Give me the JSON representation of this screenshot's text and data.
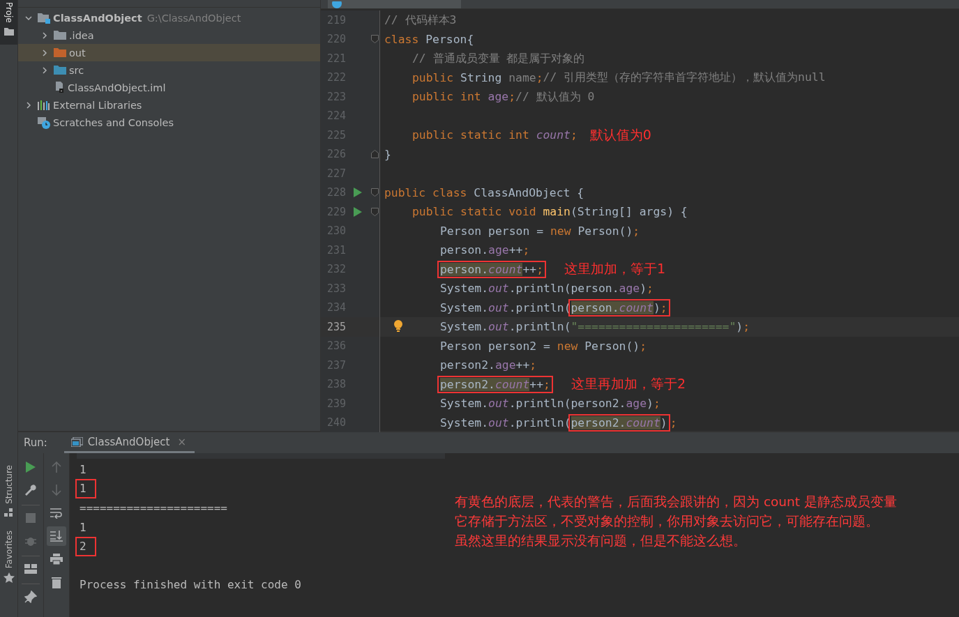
{
  "side_strip": [
    {
      "label": "Proje",
      "kind": "project",
      "selected": true
    },
    {
      "label": "Structure",
      "kind": "structure",
      "selected": false
    },
    {
      "label": "Favorites",
      "kind": "favorites",
      "selected": false
    }
  ],
  "project_tree": [
    {
      "name": "ClassAndObject",
      "path": "G:\\ClassAndObject",
      "kind": "module",
      "expanded": true,
      "selected": false,
      "children": [
        {
          "name": ".idea",
          "kind": "folder",
          "expanded": false,
          "selected": false
        },
        {
          "name": "out",
          "kind": "excluded_folder",
          "expanded": false,
          "selected": true
        },
        {
          "name": "src",
          "kind": "source_folder",
          "expanded": false,
          "selected": false
        },
        {
          "name": "ClassAndObject.iml",
          "kind": "module_file",
          "selected": false
        }
      ]
    },
    {
      "name": "External Libraries",
      "kind": "libraries",
      "expanded": false,
      "selected": false
    },
    {
      "name": "Scratches and Consoles",
      "kind": "scratches",
      "selected": false
    }
  ],
  "editor": {
    "lines": [
      {
        "number": "219",
        "current": false,
        "tokens": [
          {
            "kind": "comment",
            "text": "// 代码样本3"
          }
        ]
      },
      {
        "number": "220",
        "current": false,
        "fold_start": true,
        "tokens": [
          {
            "kind": "keyword",
            "text": "class "
          },
          {
            "kind": "plain",
            "text": "Person{"
          }
        ],
        "children": [
          {
            "number": "221",
            "current": false,
            "tokens": [
              {
                "kind": "comment",
                "text": "// 普通成员变量 都是属于对象的"
              }
            ]
          },
          {
            "number": "222",
            "current": false,
            "tokens": [
              {
                "kind": "keyword",
                "text": "public "
              },
              {
                "kind": "plain",
                "text": "String "
              },
              {
                "kind": "unused",
                "text": "name"
              },
              {
                "kind": "keyword",
                "text": ";"
              },
              {
                "kind": "comment",
                "text": "// 引用类型（存的字符串首字符地址），默认值为null"
              }
            ]
          },
          {
            "number": "223",
            "current": false,
            "tokens": [
              {
                "kind": "keyword",
                "text": "public int "
              },
              {
                "kind": "field",
                "text": "age"
              },
              {
                "kind": "keyword",
                "text": ";"
              },
              {
                "kind": "comment",
                "text": "// 默认值为 0"
              }
            ]
          },
          {
            "number": "224",
            "current": false
          },
          {
            "number": "225",
            "current": false,
            "tokens": [
              {
                "kind": "keyword",
                "text": "public static int "
              },
              {
                "kind": "static",
                "text": "count"
              },
              {
                "kind": "keyword",
                "text": ";"
              },
              {
                "kind": "note",
                "text": "默认值为0"
              }
            ]
          }
        ]
      },
      {
        "number": "226",
        "current": false,
        "fold_end": true,
        "tokens": [
          {
            "kind": "plain",
            "text": "}"
          }
        ]
      },
      {
        "number": "227",
        "current": false
      },
      {
        "number": "228",
        "current": false,
        "run": true,
        "fold_start": true,
        "tokens": [
          {
            "kind": "keyword",
            "text": "public class "
          },
          {
            "kind": "plain",
            "text": "ClassAndObject {"
          }
        ],
        "children": [
          {
            "number": "229",
            "current": false,
            "run": true,
            "fold_start": true,
            "tokens": [
              {
                "kind": "keyword",
                "text": "public static void "
              },
              {
                "kind": "method",
                "text": "main"
              },
              {
                "kind": "plain",
                "text": "(String[] args) {"
              }
            ],
            "children": [
              {
                "number": "230",
                "current": false,
                "tokens": [
                  {
                    "kind": "plain",
                    "text": "Person person = "
                  },
                  {
                    "kind": "keyword",
                    "text": "new "
                  },
                  {
                    "kind": "plain",
                    "text": "Person()"
                  },
                  {
                    "kind": "keyword",
                    "text": ";"
                  }
                ]
              },
              {
                "number": "231",
                "current": false,
                "tokens": [
                  {
                    "kind": "plain",
                    "text": "person."
                  },
                  {
                    "kind": "field",
                    "text": "age"
                  },
                  {
                    "kind": "plain",
                    "text": "++"
                  },
                  {
                    "kind": "keyword",
                    "text": ";"
                  }
                ]
              },
              {
                "number": "232",
                "current": false,
                "tokens": [
                  {
                    "kind": "box",
                    "children": [
                      {
                        "kind": "plain",
                        "text": "person.",
                        "warn": true
                      },
                      {
                        "kind": "static",
                        "text": "count",
                        "warn": true
                      },
                      {
                        "kind": "plain",
                        "text": "++"
                      },
                      {
                        "kind": "keyword",
                        "text": ";"
                      }
                    ]
                  },
                  {
                    "kind": "note",
                    "text": "这里加加，等于1"
                  }
                ]
              },
              {
                "number": "233",
                "current": false,
                "tokens": [
                  {
                    "kind": "plain",
                    "text": "System."
                  },
                  {
                    "kind": "static",
                    "text": "out"
                  },
                  {
                    "kind": "plain",
                    "text": ".println(person."
                  },
                  {
                    "kind": "field",
                    "text": "age"
                  },
                  {
                    "kind": "plain",
                    "text": ")"
                  },
                  {
                    "kind": "keyword",
                    "text": ";"
                  }
                ]
              },
              {
                "number": "234",
                "current": false,
                "tokens": [
                  {
                    "kind": "plain",
                    "text": "System."
                  },
                  {
                    "kind": "static",
                    "text": "out"
                  },
                  {
                    "kind": "plain",
                    "text": ".println("
                  },
                  {
                    "kind": "box",
                    "children": [
                      {
                        "kind": "plain",
                        "text": "person.",
                        "warn": true
                      },
                      {
                        "kind": "static",
                        "text": "count",
                        "warn": true
                      },
                      {
                        "kind": "plain",
                        "text": ")"
                      },
                      {
                        "kind": "keyword",
                        "text": ";"
                      }
                    ]
                  }
                ]
              },
              {
                "number": "235",
                "current": true,
                "bulb": true,
                "tokens": [
                  {
                    "kind": "plain",
                    "text": "System."
                  },
                  {
                    "kind": "static",
                    "text": "out"
                  },
                  {
                    "kind": "plain",
                    "text": ".println("
                  },
                  {
                    "kind": "string",
                    "text": "\"======================\""
                  },
                  {
                    "kind": "plain",
                    "text": ")"
                  },
                  {
                    "kind": "keyword",
                    "text": ";"
                  }
                ]
              },
              {
                "number": "236",
                "current": false,
                "tokens": [
                  {
                    "kind": "plain",
                    "text": "Person person2 = "
                  },
                  {
                    "kind": "keyword",
                    "text": "new "
                  },
                  {
                    "kind": "plain",
                    "text": "Person()"
                  },
                  {
                    "kind": "keyword",
                    "text": ";"
                  }
                ]
              },
              {
                "number": "237",
                "current": false,
                "tokens": [
                  {
                    "kind": "plain",
                    "text": "person2."
                  },
                  {
                    "kind": "field",
                    "text": "age"
                  },
                  {
                    "kind": "plain",
                    "text": "++"
                  },
                  {
                    "kind": "keyword",
                    "text": ";"
                  }
                ]
              },
              {
                "number": "238",
                "current": false,
                "tokens": [
                  {
                    "kind": "box",
                    "children": [
                      {
                        "kind": "plain",
                        "text": "person2.",
                        "warn": true
                      },
                      {
                        "kind": "static",
                        "text": "count",
                        "warn": true
                      },
                      {
                        "kind": "plain",
                        "text": "++"
                      },
                      {
                        "kind": "keyword",
                        "text": ";"
                      }
                    ]
                  },
                  {
                    "kind": "note",
                    "text": "这里再加加，等于2"
                  }
                ]
              },
              {
                "number": "239",
                "current": false,
                "tokens": [
                  {
                    "kind": "plain",
                    "text": "System."
                  },
                  {
                    "kind": "static",
                    "text": "out"
                  },
                  {
                    "kind": "plain",
                    "text": ".println(person2."
                  },
                  {
                    "kind": "field",
                    "text": "age"
                  },
                  {
                    "kind": "plain",
                    "text": ")"
                  },
                  {
                    "kind": "keyword",
                    "text": ";"
                  }
                ]
              },
              {
                "number": "240",
                "current": false,
                "tokens": [
                  {
                    "kind": "plain",
                    "text": "System."
                  },
                  {
                    "kind": "static",
                    "text": "out"
                  },
                  {
                    "kind": "plain",
                    "text": ".println("
                  },
                  {
                    "kind": "box",
                    "children": [
                      {
                        "kind": "plain",
                        "text": "person2.",
                        "warn": true
                      },
                      {
                        "kind": "static",
                        "text": "count",
                        "warn": true
                      },
                      {
                        "kind": "plain",
                        "text": ")"
                      }
                    ]
                  },
                  {
                    "kind": "keyword",
                    "text": ";"
                  }
                ]
              }
            ]
          }
        ]
      }
    ]
  },
  "run_panel": {
    "label": "Run:",
    "tab": {
      "title": "ClassAndObject",
      "close": "×",
      "selected": true
    },
    "toolbar_left": [
      {
        "kind": "run",
        "disabled": false
      },
      {
        "kind": "wrench",
        "disabled": false
      },
      {
        "kind": "separator"
      },
      {
        "kind": "stop",
        "disabled": true
      },
      {
        "kind": "bug",
        "disabled": true
      },
      {
        "kind": "separator"
      },
      {
        "kind": "layout",
        "disabled": false
      },
      {
        "kind": "separator"
      },
      {
        "kind": "pin",
        "disabled": false
      }
    ],
    "toolbar_right": [
      {
        "kind": "up",
        "disabled": true
      },
      {
        "kind": "down",
        "disabled": true
      },
      {
        "kind": "wrap",
        "disabled": false,
        "selected": false
      },
      {
        "kind": "scroll_end",
        "disabled": false,
        "selected": true
      },
      {
        "kind": "print",
        "disabled": false
      },
      {
        "kind": "trash",
        "disabled": false
      }
    ],
    "console": [
      {
        "kind": "output",
        "text": "1",
        "boxed": false
      },
      {
        "kind": "output",
        "text": "1",
        "boxed": true
      },
      {
        "kind": "output",
        "text": "======================",
        "boxed": false
      },
      {
        "kind": "output",
        "text": "1",
        "boxed": false
      },
      {
        "kind": "output",
        "text": "2",
        "boxed": true
      },
      {
        "kind": "exit",
        "text": "Process finished with exit code 0",
        "boxed": false
      }
    ],
    "note": [
      "有黄色的底层，代表的警告，后面我会跟讲的，因为 count 是静态成员变量",
      "它存储于方法区，不受对象的控制，你用对象去访问它，可能存在问题。",
      "虽然这里的结果显示没有问题，但是不能这么想。"
    ]
  }
}
